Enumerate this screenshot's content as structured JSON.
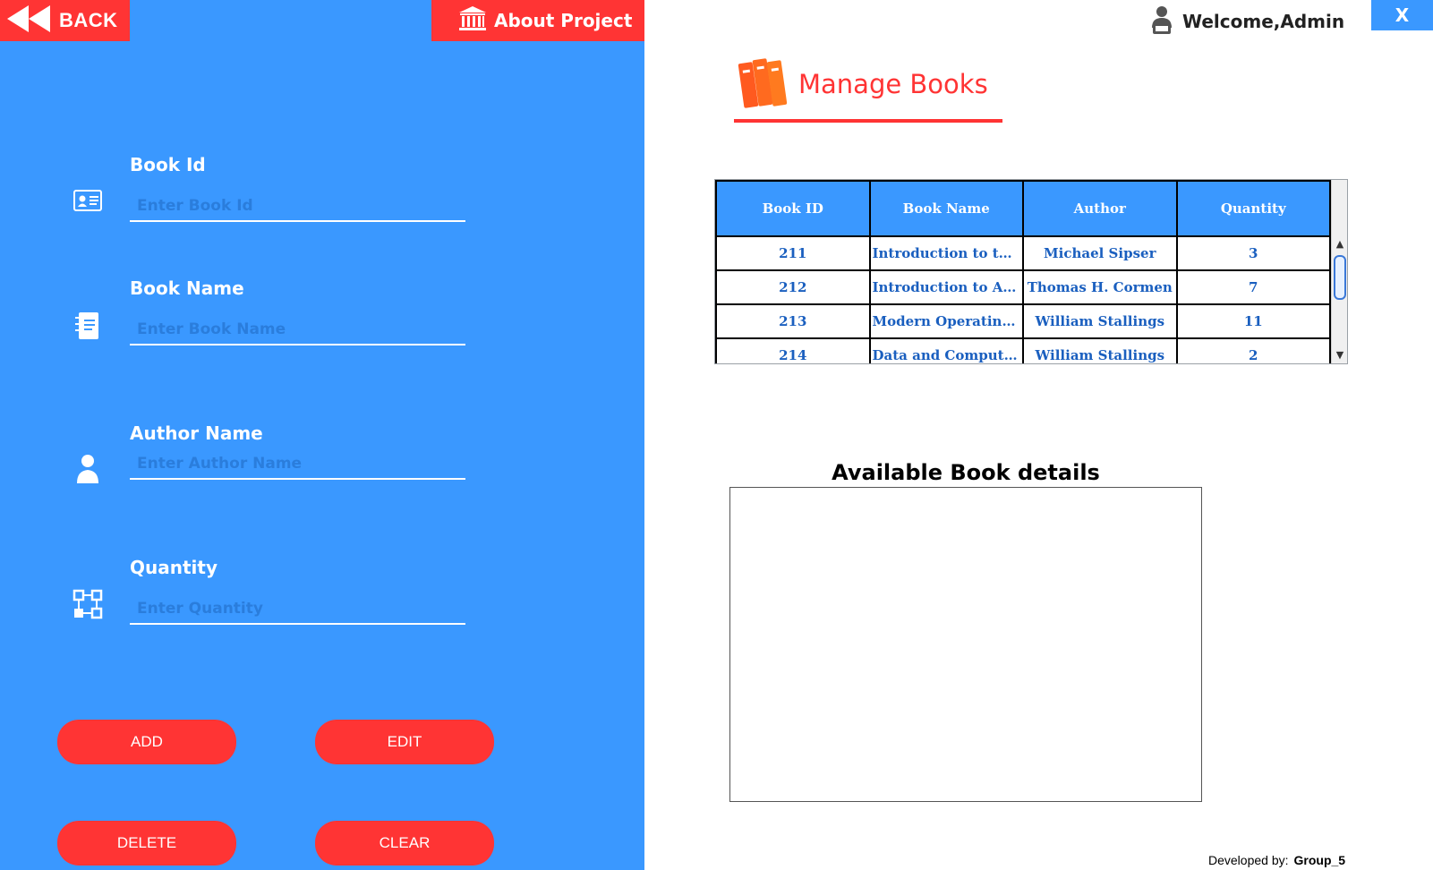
{
  "header": {
    "back_label": "BACK",
    "about_label": "About Project",
    "welcome_label": "Welcome,Admin",
    "close_label": "X"
  },
  "form": {
    "book_id": {
      "label": "Book Id",
      "placeholder": "Enter Book Id",
      "value": ""
    },
    "book_name": {
      "label": "Book Name",
      "placeholder": "Enter Book Name",
      "value": ""
    },
    "author_name": {
      "label": "Author Name",
      "placeholder": "Enter Author Name",
      "value": ""
    },
    "quantity": {
      "label": "Quantity",
      "placeholder": "Enter Quantity",
      "value": ""
    }
  },
  "actions": {
    "add_label": "ADD",
    "edit_label": "EDIT",
    "delete_label": "DELETE",
    "clear_label": "CLEAR"
  },
  "main": {
    "title": "Manage Books",
    "details_heading": "Available Book details"
  },
  "table": {
    "columns": [
      "Book ID",
      "Book Name",
      "Author",
      "Quantity"
    ],
    "rows": [
      [
        "211",
        "Introduction to the T...",
        "Michael Sipser",
        "3"
      ],
      [
        "212",
        "Introduction to Algo...",
        "Thomas H. Cormen",
        "7"
      ],
      [
        "213",
        "Modern Operating S...",
        "William Stallings",
        "11"
      ],
      [
        "214",
        "Data and Computer C...",
        "William Stallings",
        "2"
      ]
    ]
  },
  "footer": {
    "developed_label": "Developed by:",
    "group_label": "Group_5"
  },
  "colors": {
    "panel_blue": "#3a98ff",
    "accent_red": "#ff3434",
    "cell_text_blue": "#1a5fbf"
  },
  "icons": {
    "back": "rewind-icon",
    "about": "bank-building-icon",
    "welcome": "user-icon",
    "title": "books-icon",
    "book_id": "id-card-icon",
    "book_name": "notebook-icon",
    "author_name": "person-icon",
    "quantity": "flowchart-icon"
  }
}
